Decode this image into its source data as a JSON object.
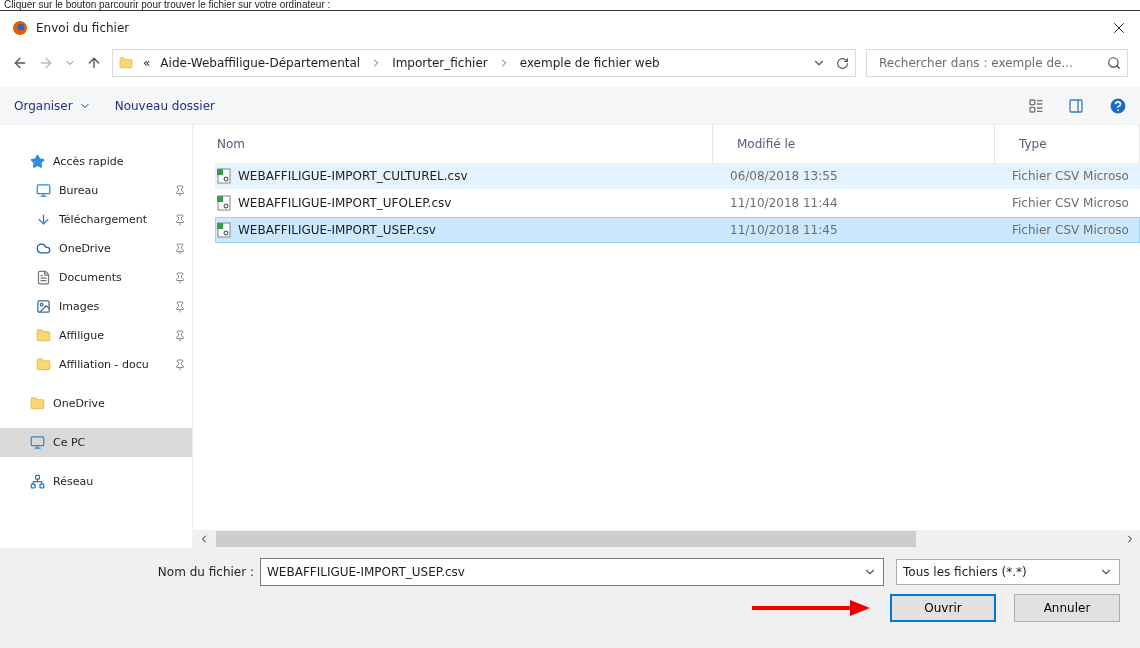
{
  "instruction": "Cliquer sur le bouton parcourir pour trouver le fichier sur votre ordinateur :",
  "window": {
    "title": "Envoi du fichier"
  },
  "address": {
    "overflow": "«",
    "crumbs": [
      "Aide-Webaffiligue-Départemental",
      "Importer_fichier",
      "exemple de fichier web"
    ]
  },
  "search": {
    "placeholder": "Rechercher dans : exemple de..."
  },
  "toolbar": {
    "organize": "Organiser",
    "new_folder": "Nouveau dossier"
  },
  "sidebar": {
    "items": [
      {
        "label": "Accès rapide",
        "kind": "star",
        "pinned": false,
        "selected": false,
        "children": [
          {
            "label": "Bureau",
            "kind": "desktop",
            "pinned": true,
            "selected": false
          },
          {
            "label": "Téléchargement",
            "kind": "download",
            "pinned": true,
            "selected": false
          },
          {
            "label": "OneDrive",
            "kind": "onedrive",
            "pinned": true,
            "selected": false
          },
          {
            "label": "Documents",
            "kind": "document",
            "pinned": true,
            "selected": false
          },
          {
            "label": "Images",
            "kind": "image",
            "pinned": true,
            "selected": false
          },
          {
            "label": "Affiligue",
            "kind": "folder",
            "pinned": true,
            "selected": false
          },
          {
            "label": "Affiliation - docu",
            "kind": "folder",
            "pinned": true,
            "selected": false
          }
        ]
      },
      {
        "label": "OneDrive",
        "kind": "folder",
        "pinned": false,
        "selected": false
      },
      {
        "label": "Ce PC",
        "kind": "pc",
        "pinned": false,
        "selected": true
      },
      {
        "label": "Réseau",
        "kind": "network",
        "pinned": false,
        "selected": false
      }
    ]
  },
  "table": {
    "columns": [
      "Nom",
      "Modifié le",
      "Type"
    ],
    "rows": [
      {
        "name": "WEBAFFILIGUE-IMPORT_CULTUREL.csv",
        "modified": "06/08/2018 13:55",
        "type": "Fichier CSV Microso",
        "selected": false,
        "hovered": true
      },
      {
        "name": "WEBAFFILIGUE-IMPORT_UFOLEP.csv",
        "modified": "11/10/2018 11:44",
        "type": "Fichier CSV Microso",
        "selected": false,
        "hovered": false
      },
      {
        "name": "WEBAFFILIGUE-IMPORT_USEP.csv",
        "modified": "11/10/2018 11:45",
        "type": "Fichier CSV Microso",
        "selected": true,
        "hovered": false
      }
    ]
  },
  "footer": {
    "filename_label": "Nom du fichier :",
    "filename": "WEBAFFILIGUE-IMPORT_USEP.csv",
    "filter": "Tous les fichiers (*.*)",
    "open": "Ouvrir",
    "cancel": "Annuler"
  }
}
